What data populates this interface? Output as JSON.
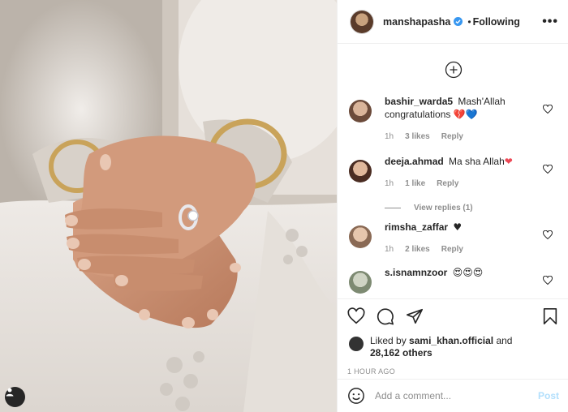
{
  "post": {
    "author": "manshapasha",
    "follow_status": "Following",
    "separator": "•",
    "more_icon": "more-horizontal-icon"
  },
  "comments": [
    {
      "user": "bashir_warda5",
      "text": "Mash'Allah congratulations",
      "emoji": "💔💙",
      "time": "1h",
      "likes": "3 likes",
      "reply": "Reply",
      "avatar_color": "#6b4a3a"
    },
    {
      "user": "deeja.ahmad",
      "text": "Ma sha Allah",
      "emoji": "❤",
      "time": "1h",
      "likes": "1 like",
      "reply": "Reply",
      "view_replies": "View replies (1)",
      "avatar_color": "#5b3a2c"
    },
    {
      "user": "rimsha_zaffar",
      "text": "",
      "emoji": "♥",
      "time": "1h",
      "likes": "2 likes",
      "reply": "Reply",
      "avatar_color": "#8a6a55"
    },
    {
      "user": "s.isnamnzoor",
      "text": "",
      "emoji": "😍😍😍",
      "avatar_color": "#7d8a72"
    }
  ],
  "actions": {
    "liked_prefix": "Liked by",
    "liked_user": "sami_khan.official",
    "liked_and": "and",
    "liked_count": "28,162 others",
    "time_ago": "1 HOUR AGO"
  },
  "add_comment": {
    "placeholder": "Add a comment...",
    "post_label": "Post"
  },
  "colors": {
    "verified": "#3897f0",
    "post_disabled": "#b2dffc",
    "muted": "#8e8e8e"
  }
}
